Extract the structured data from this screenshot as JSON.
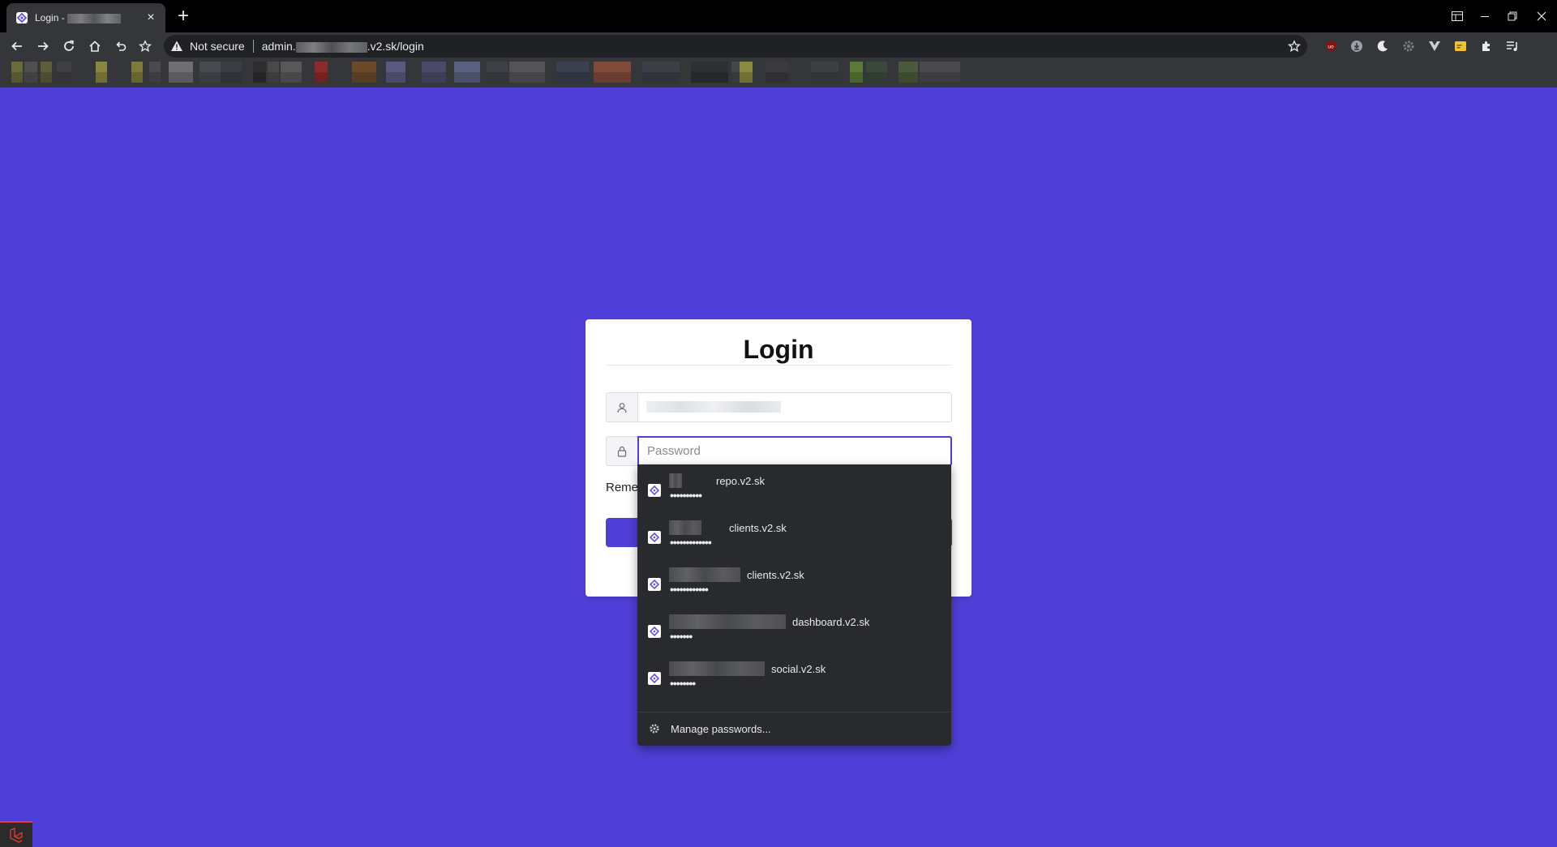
{
  "browser": {
    "tab": {
      "title_prefix": "Login - ",
      "close_glyph": "×"
    },
    "new_tab_glyph": "+",
    "omnibox": {
      "security_text": "Not secure",
      "url_prefix": "admin.",
      "url_suffix": ".v2.sk/login"
    },
    "icons": [
      "back-arrow-icon",
      "forward-arrow-icon",
      "reload-icon",
      "home-icon",
      "undo-icon",
      "bookmark-star-icon",
      "warning-triangle-icon"
    ],
    "window_controls": [
      "tab-search",
      "minimize",
      "restore",
      "close"
    ]
  },
  "login": {
    "title": "Login",
    "password_placeholder": "Password",
    "remember_label": "Reme"
  },
  "autofill": {
    "credentials": [
      {
        "site": "repo.v2.sk",
        "password_mask": "••••••••••"
      },
      {
        "site": "clients.v2.sk",
        "password_mask": "•••••••••••••"
      },
      {
        "site": "clients.v2.sk",
        "password_mask": "••••••••••••"
      },
      {
        "site": "dashboard.v2.sk",
        "password_mask": "•••••••"
      },
      {
        "site": "social.v2.sk",
        "password_mask": "••••••••"
      }
    ],
    "manage_label": "Manage passwords..."
  },
  "colors": {
    "page_background": "#4f3fd8",
    "accent": "#4f3fd8",
    "chrome_dark": "#35363a",
    "dropdown": "#292a2d"
  }
}
